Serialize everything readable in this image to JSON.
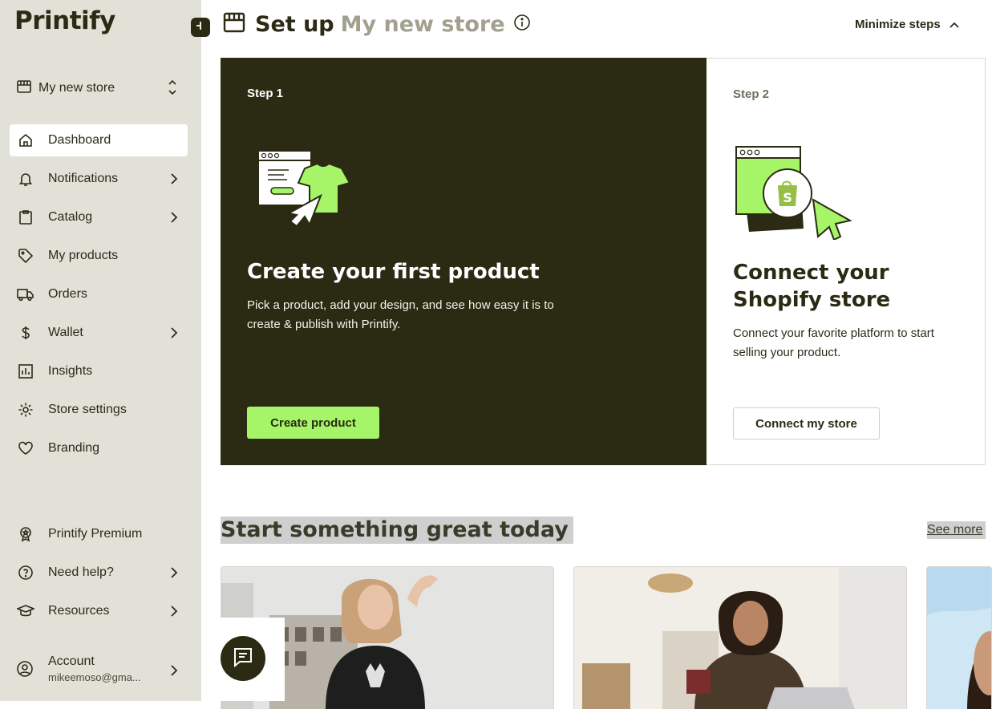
{
  "sidebar": {
    "logo": "Printify",
    "store_name": "My new store",
    "nav": [
      {
        "label": "Dashboard"
      },
      {
        "label": "Notifications"
      },
      {
        "label": "Catalog"
      },
      {
        "label": "My products"
      },
      {
        "label": "Orders"
      },
      {
        "label": "Wallet"
      },
      {
        "label": "Insights"
      },
      {
        "label": "Store settings"
      },
      {
        "label": "Branding"
      }
    ],
    "bottom_nav": [
      {
        "label": "Printify Premium"
      },
      {
        "label": "Need help?"
      },
      {
        "label": "Resources"
      }
    ],
    "account": {
      "label": "Account",
      "email": "mikeemoso@gma..."
    }
  },
  "header": {
    "title_prefix": "Set up",
    "title_store": "My new store",
    "minimize_label": "Minimize steps"
  },
  "steps": [
    {
      "label": "Step 1",
      "heading": "Create your first product",
      "description": "Pick a product, add your design, and see how easy it is to create & publish with Printify.",
      "button": "Create product"
    },
    {
      "label": "Step 2",
      "heading": "Connect your Shopify store",
      "description": "Connect your favorite platform to start selling your product.",
      "button": "Connect my store"
    }
  ],
  "start_section": {
    "title": "Start something great today",
    "see_more": "See more"
  },
  "colors": {
    "sidebar_bg": "#e2e1d8",
    "dark": "#2b2b14",
    "accent_green": "#a6f569",
    "muted": "#a2a190"
  }
}
